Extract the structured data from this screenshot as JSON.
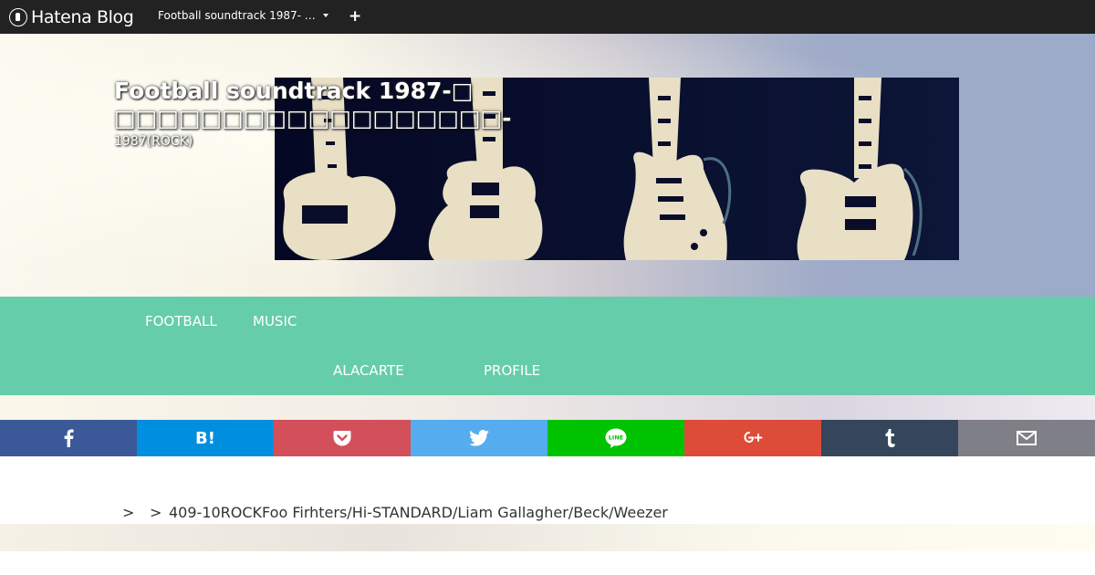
{
  "topbar": {
    "brand": "Hatena Blog",
    "blog_selector": "Football soundtrack 1987-  …",
    "add_label": "+"
  },
  "header": {
    "title": "Football soundtrack 1987-□",
    "title_line2": "□□□□□□□□□□□□□□□□□□-",
    "description": "1987(ROCK)"
  },
  "nav": {
    "items": [
      "FOOTBALL",
      "MUSIC",
      "ALACARTE",
      "PROFILE"
    ]
  },
  "share": {
    "colors": {
      "facebook": "#3b5998",
      "hatena": "#008fde",
      "pocket": "#d3505a",
      "twitter": "#55acee",
      "line": "#00c300",
      "googleplus": "#dd4b39",
      "tumblr": "#35465c",
      "email": "#7f7f88"
    },
    "labels": {
      "hatena": "B!",
      "line": "LINE"
    }
  },
  "breadcrumb": {
    "sep1": ">",
    "sep2": ">",
    "current": "409-10ROCKFoo Firhters/Hi-STANDARD/Liam Gallagher/Beck/Weezer"
  },
  "theme": {
    "nav_color": "#66cdaa",
    "topbar_color": "#222222"
  }
}
